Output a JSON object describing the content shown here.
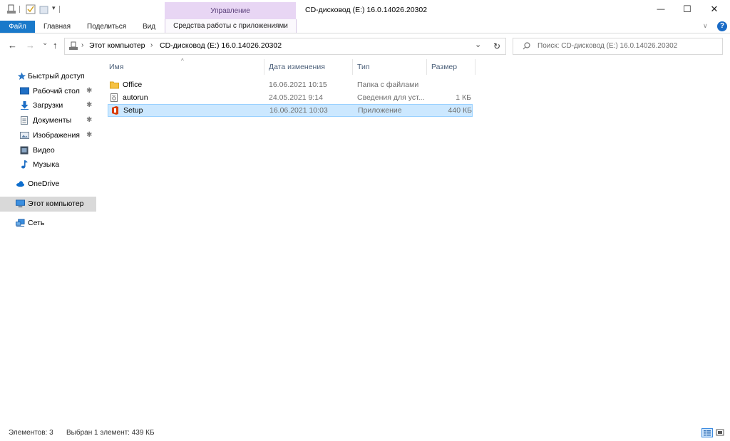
{
  "window": {
    "title": "CD-дисковод (E:) 16.0.14026.20302",
    "context_header": "Управление",
    "controls": {
      "minimize": "—",
      "maximize": "☐",
      "close": "✕"
    }
  },
  "quick_access_toolbar": {
    "icons": [
      "properties-icon",
      "checkmark-icon",
      "new-folder-icon",
      "customize-arrow-icon"
    ],
    "dropdown_glyph": "▾"
  },
  "ribbon": {
    "file_tab": "Файл",
    "tabs": [
      "Главная",
      "Поделиться",
      "Вид"
    ],
    "context_tab": "Средства работы с приложениями",
    "expand_glyph": "∨",
    "help_glyph": "?"
  },
  "navigation": {
    "back": "←",
    "forward": "→",
    "recent": "⌄",
    "up": "↑",
    "breadcrumb": [
      "Этот компьютер",
      "CD-дисковод (E:) 16.0.14026.20302"
    ],
    "separator": "›",
    "dropdown": "⌄",
    "refresh": "↻"
  },
  "search": {
    "placeholder": "Поиск: CD-дисковод (E:) 16.0.14026.20302",
    "icon": "search-icon"
  },
  "sidebar": {
    "pin_glyph": "✱",
    "items": [
      {
        "label": "Быстрый доступ",
        "icon": "star-icon",
        "pinned": false,
        "selected": false
      },
      {
        "label": "Рабочий стол",
        "icon": "desktop-icon",
        "pinned": true,
        "selected": false
      },
      {
        "label": "Загрузки",
        "icon": "download-icon",
        "pinned": true,
        "selected": false
      },
      {
        "label": "Документы",
        "icon": "documents-icon",
        "pinned": true,
        "selected": false
      },
      {
        "label": "Изображения",
        "icon": "pictures-icon",
        "pinned": true,
        "selected": false
      },
      {
        "label": "Видео",
        "icon": "video-icon",
        "pinned": false,
        "selected": false
      },
      {
        "label": "Музыка",
        "icon": "music-icon",
        "pinned": false,
        "selected": false
      },
      {
        "label": "OneDrive",
        "icon": "cloud-icon",
        "pinned": false,
        "selected": false
      },
      {
        "label": "Этот компьютер",
        "icon": "computer-icon",
        "pinned": false,
        "selected": true
      },
      {
        "label": "Сеть",
        "icon": "network-icon",
        "pinned": false,
        "selected": false
      }
    ]
  },
  "file_list": {
    "sort_glyph": "^",
    "columns": [
      "Имя",
      "Дата изменения",
      "Тип",
      "Размер"
    ],
    "rows": [
      {
        "name": "Office",
        "date": "16.06.2021 10:15",
        "type": "Папка с файлами",
        "size": "",
        "icon": "folder-icon",
        "selected": false
      },
      {
        "name": "autorun",
        "date": "24.05.2021 9:14",
        "type": "Сведения для уст...",
        "size": "1 КБ",
        "icon": "settings-file-icon",
        "selected": false
      },
      {
        "name": "Setup",
        "date": "16.06.2021 10:03",
        "type": "Приложение",
        "size": "440 КБ",
        "icon": "office-icon",
        "selected": true
      }
    ]
  },
  "status": {
    "count": "Элементов: 3",
    "selection": "Выбран 1 элемент: 439 КБ",
    "view_buttons": [
      "details-view-icon",
      "large-icons-view-icon"
    ]
  },
  "colors": {
    "accent": "#1979ca",
    "context_header": "#e8d6f4",
    "selection_bg": "#cce8ff",
    "selection_border": "#99d1ff",
    "folder": "#f6c243",
    "office_red": "#d83b01"
  }
}
